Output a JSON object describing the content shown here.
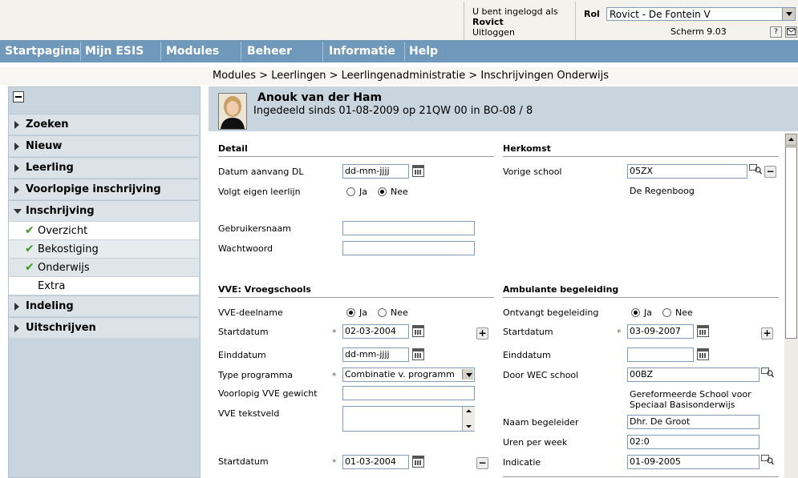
{
  "header": {
    "login_line1": "U bent ingelogd als",
    "login_user": "Rovict",
    "logout": "Uitloggen",
    "rol_label": "Rol",
    "rol_value": "Rovict - De Fontein V",
    "screen": "Scherm 9.03",
    "help_btn": "?"
  },
  "nav": [
    "Startpagina",
    "Mijn ESIS",
    "Modules",
    "Beheer",
    "Informatie",
    "Help"
  ],
  "breadcrumb": "Modules > Leerlingen > Leerlingenadministratie > Inschrijvingen Onderwijs",
  "sidebar": {
    "items": [
      {
        "label": "Zoeken"
      },
      {
        "label": "Nieuw"
      },
      {
        "label": "Leerling"
      },
      {
        "label": "Voorlopige inschrijving"
      },
      {
        "label": "Inschrijving"
      },
      {
        "label": "Indeling"
      },
      {
        "label": "Uitschrijven"
      }
    ],
    "subitems": [
      {
        "label": "Overzicht"
      },
      {
        "label": "Bekostiging"
      },
      {
        "label": "Onderwijs"
      },
      {
        "label": "Extra"
      }
    ]
  },
  "student": {
    "name": "Anouk van der Ham",
    "info": "Ingedeeld sinds 01-08-2009 op 21QW 00 in BO-08 / 8"
  },
  "detail": {
    "title": "Detail",
    "datum_label": "Datum aanvang DL",
    "datum_value": "dd-mm-jjjj",
    "leerlijn_label": "Volgt eigen leerlijn",
    "ja": "Ja",
    "nee": "Nee",
    "gebruikersnaam_label": "Gebruikersnaam",
    "wachtwoord_label": "Wachtwoord"
  },
  "herkomst": {
    "title": "Herkomst",
    "school_label": "Vorige school",
    "school_code": "05ZX",
    "school_name": "De Regenboog"
  },
  "vve": {
    "title": "VVE: Vroegschools",
    "deelname_label": "VVE-deelname",
    "ja": "Ja",
    "nee": "Nee",
    "start_label": "Startdatum",
    "start_value": "02-03-2004",
    "eind_label": "Einddatum",
    "eind_value": "dd-mm-jjjj",
    "type_label": "Type programma",
    "type_value": "Combinatie v. programm",
    "gewicht_label": "Voorlopig VVE gewicht",
    "tekst_label": "VVE tekstveld",
    "start2_label": "Startdatum",
    "start2_value": "01-03-2004",
    "required": "*"
  },
  "ambulant": {
    "title": "Ambulante begeleiding",
    "ontvangt_label": "Ontvangt begeleiding",
    "ja": "Ja",
    "nee": "Nee",
    "start_label": "Startdatum",
    "start_value": "03-09-2007",
    "eind_label": "Einddatum",
    "wec_label": "Door WEC school",
    "wec_value": "00BZ",
    "wec_name_1": "Gereformeerde School voor",
    "wec_name_2": "Speciaal Basisonderwijs",
    "begeleider_label": "Naam begeleider",
    "begeleider_value": "Dhr. De Groot",
    "uren_label": "Uren per week",
    "uren_value": "02:0",
    "indicatie_label": "Indicatie",
    "indicatie_value": "01-09-2005"
  }
}
